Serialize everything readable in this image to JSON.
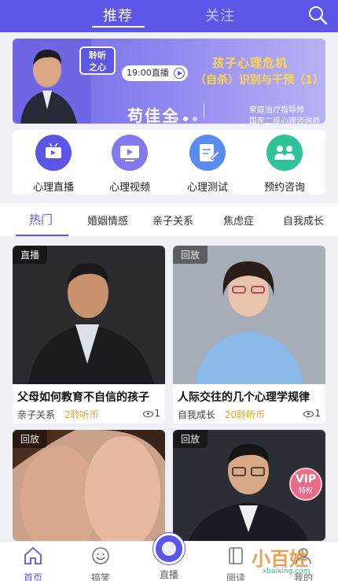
{
  "header": {
    "tabs": [
      {
        "label": "推荐",
        "active": true
      },
      {
        "label": "关注",
        "active": false
      }
    ]
  },
  "banner": {
    "logo_line1": "聆听",
    "logo_line2": "之心",
    "time": "19:00直播",
    "title_line1": "孩子心理危机",
    "title_line2": "（自杀）识别与干预（1）",
    "speaker": "苟佳全",
    "role_line1": "家庭治疗指导师",
    "role_line2": "国家二级心理咨询师"
  },
  "quick_nav": [
    {
      "label": "心理直播",
      "icon": "tv-icon",
      "color": "#5b56e8"
    },
    {
      "label": "心理视频",
      "icon": "video-icon",
      "color": "#7d6cf0"
    },
    {
      "label": "心理测试",
      "icon": "edit-icon",
      "color": "#5a8cf0"
    },
    {
      "label": "预约咨询",
      "icon": "group-icon",
      "color": "#2fc39a"
    }
  ],
  "categories": [
    {
      "label": "热门",
      "active": true
    },
    {
      "label": "婚姻情感"
    },
    {
      "label": "亲子关系"
    },
    {
      "label": "焦虑症"
    },
    {
      "label": "自我成长"
    }
  ],
  "cards": [
    {
      "tag": "直播",
      "title": "父母如何教育不自信的孩子",
      "category": "亲子关系",
      "price": "2聆听币",
      "views": "1"
    },
    {
      "tag": "回放",
      "title": "人际交往的几个心理学规律",
      "category": "自我成长",
      "price": "20聆听币",
      "views": "1"
    },
    {
      "tag": "回放",
      "title": "",
      "category": "",
      "price": "",
      "views": ""
    },
    {
      "tag": "回放",
      "title": "",
      "category": "",
      "price": "",
      "views": "",
      "vip_label": "VIP",
      "vip_sub": "特权"
    }
  ],
  "bottom_nav": [
    {
      "label": "首页",
      "icon": "home-icon",
      "active": true
    },
    {
      "label": "搞笑",
      "icon": "smile-icon"
    },
    {
      "label": "直播",
      "icon": "live-icon"
    },
    {
      "label": "阅读",
      "icon": "book-icon"
    },
    {
      "label": "我的",
      "icon": "user-icon"
    }
  ],
  "watermark": {
    "text": "小百姓",
    "url": "xbaixing.com"
  },
  "colors": {
    "accent": "#5b56e8",
    "price": "#f2a21a"
  }
}
